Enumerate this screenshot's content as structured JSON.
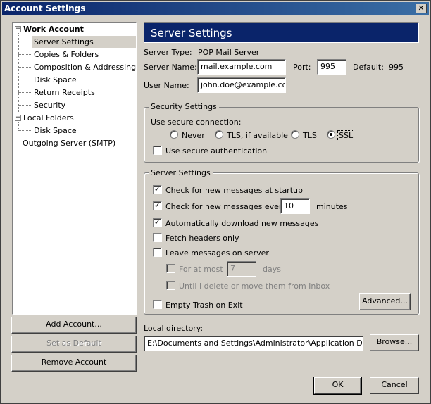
{
  "window": {
    "title": "Account Settings",
    "close_glyph": "✕"
  },
  "tree": {
    "items": [
      {
        "label": "Work Account",
        "expander": "−"
      },
      {
        "label": "Server Settings"
      },
      {
        "label": "Copies & Folders"
      },
      {
        "label": "Composition & Addressing"
      },
      {
        "label": "Disk Space"
      },
      {
        "label": "Return Receipts"
      },
      {
        "label": "Security"
      },
      {
        "label": "Local Folders",
        "expander": "−"
      },
      {
        "label": "Disk Space"
      },
      {
        "label": "Outgoing Server (SMTP)"
      }
    ]
  },
  "left_buttons": {
    "add_account": "Add Account...",
    "set_default": "Set as Default",
    "remove_account": "Remove Account"
  },
  "panel": {
    "header": "Server Settings",
    "server_type_label": "Server Type:",
    "server_type_value": "POP Mail Server",
    "server_name_label": "Server Name:",
    "server_name_value": "mail.example.com",
    "port_label": "Port:",
    "port_value": "995",
    "default_label": "Default:",
    "default_value": "995",
    "user_name_label": "User Name:",
    "user_name_value": "john.doe@example.com"
  },
  "security": {
    "title": "Security Settings",
    "use_secure_label": "Use secure connection:",
    "options": [
      "Never",
      "TLS, if available",
      "TLS",
      "SSL"
    ],
    "selected": "SSL",
    "secure_auth_label": "Use secure authentication",
    "secure_auth_checked": false
  },
  "server_settings": {
    "title": "Server Settings",
    "check_startup_label": "Check for new messages at startup",
    "check_startup_checked": true,
    "check_every_label": "Check for new messages every",
    "check_every_checked": true,
    "check_every_value": "10",
    "minutes_label": "minutes",
    "auto_download_label": "Automatically download new messages",
    "auto_download_checked": true,
    "fetch_headers_label": "Fetch headers only",
    "fetch_headers_checked": false,
    "leave_messages_label": "Leave messages on server",
    "leave_messages_checked": false,
    "for_at_most_label": "For at most",
    "for_at_most_value": "7",
    "days_label": "days",
    "until_delete_label": "Until I delete or move them from Inbox",
    "empty_trash_label": "Empty Trash on Exit",
    "empty_trash_checked": false,
    "advanced_button": "Advanced..."
  },
  "local_directory": {
    "label": "Local directory:",
    "value": "E:\\Documents and Settings\\Administrator\\Application Data\\Thur",
    "browse_button": "Browse..."
  },
  "footer": {
    "ok": "OK",
    "cancel": "Cancel"
  },
  "glyphs": {
    "check": "✓"
  }
}
